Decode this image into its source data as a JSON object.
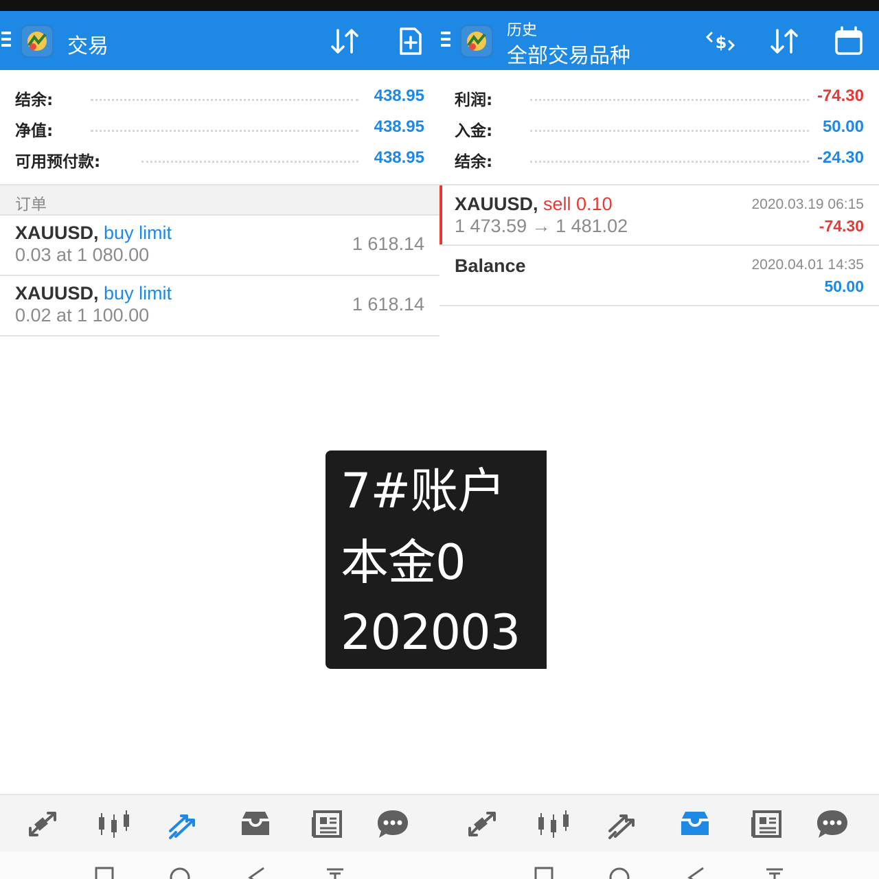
{
  "colors": {
    "accent": "#1e88e5",
    "loss": "#e53935",
    "toolbar": "#1e88e5"
  },
  "left": {
    "title": "交易",
    "icons": [
      "menu-icon",
      "metatrader-logo",
      "sort-icon",
      "new-order-icon"
    ],
    "summary": [
      {
        "label": "结余:",
        "value": "438.95"
      },
      {
        "label": "净值:",
        "value": "438.95"
      },
      {
        "label": "可用预付款:",
        "value": "438.95"
      }
    ],
    "section_label": "订单",
    "orders": [
      {
        "symbol": "XAUUSD,",
        "type": "buy limit",
        "detail": "0.03 at 1 080.00",
        "price": "1 618.14"
      },
      {
        "symbol": "XAUUSD,",
        "type": "buy limit",
        "detail": "0.02 at 1 100.00",
        "price": "1 618.14"
      }
    ],
    "nav": [
      "quotes-icon",
      "chart-icon",
      "trade-icon",
      "history-icon",
      "news-icon",
      "chat-icon"
    ],
    "nav_active": "trade-icon"
  },
  "right": {
    "title_small": "历史",
    "title_large": "全部交易品种",
    "icons": [
      "menu-icon",
      "metatrader-logo",
      "currency-exchange-icon",
      "sort-icon",
      "calendar-icon"
    ],
    "summary": [
      {
        "label": "利润:",
        "value": "-74.30",
        "color": "#e53935"
      },
      {
        "label": "入金:",
        "value": "50.00",
        "color": "#1e88e5"
      },
      {
        "label": "结余:",
        "value": "-24.30",
        "color": "#1e88e5"
      }
    ],
    "deals": [
      {
        "symbol": "XAUUSD,",
        "type": "sell 0.10",
        "detail": "1 473.59 → 1 481.02",
        "time": "2020.03.19 06:15",
        "profit": "-74.30"
      },
      {
        "symbol": "Balance",
        "type": "",
        "detail": "",
        "time": "2020.04.01 14:35",
        "profit": "50.00"
      }
    ],
    "nav": [
      "quotes-icon",
      "chart-icon",
      "trade-icon",
      "history-icon",
      "news-icon",
      "chat-icon"
    ],
    "nav_active": "history-icon"
  },
  "overlay": {
    "lines": [
      "7#账户",
      "本金0",
      "202003"
    ]
  }
}
